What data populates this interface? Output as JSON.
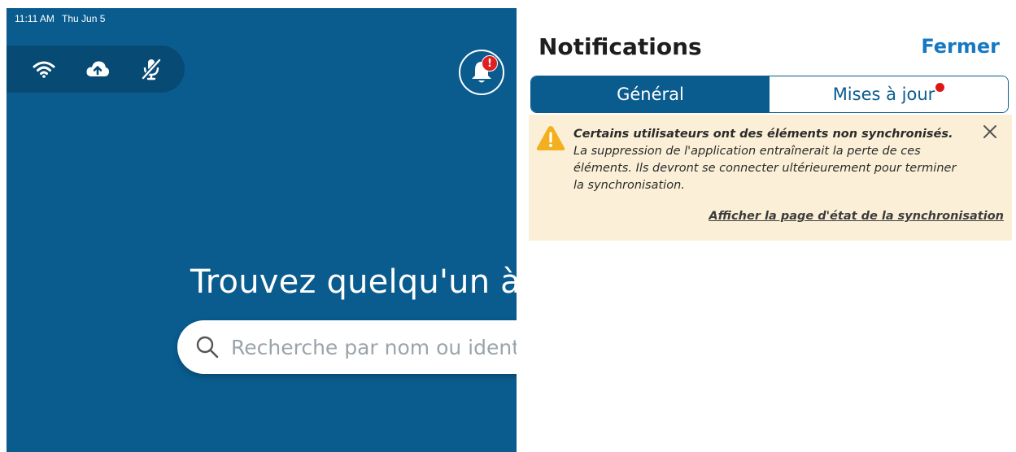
{
  "status_bar": {
    "time": "11:11 AM",
    "date": "Thu Jun 5"
  },
  "connection_icons": [
    "wifi-icon",
    "cloud-upload-icon",
    "microphone-off-icon"
  ],
  "main": {
    "title": "Trouvez quelqu'un à",
    "search": {
      "placeholder": "Recherche par nom ou identi",
      "value": ""
    }
  },
  "notification_bell": {
    "badge": "!",
    "icon": "bell-icon"
  },
  "panel": {
    "title": "Notifications",
    "close_label": "Fermer",
    "tabs": [
      {
        "label": "Général",
        "active": true
      },
      {
        "label": "Mises à jour",
        "active": false,
        "has_dot": true
      }
    ],
    "alert": {
      "bold_text": "Certains utilisateurs ont des éléments non synchronisés.",
      "body_text": " La suppression de l'application entraînerait la perte de ces éléments. Ils devront se connecter ultérieurement pour terminer la synchronisation.",
      "link_text": "Afficher la page d'état de la synchronisation"
    }
  },
  "colors": {
    "app_blue": "#0a5c8f",
    "pill_blue": "#074a74",
    "link_blue": "#1679c2",
    "alert_bg": "#fbf0d7",
    "warning_yellow": "#f2b01e",
    "badge_red": "#e02020"
  }
}
